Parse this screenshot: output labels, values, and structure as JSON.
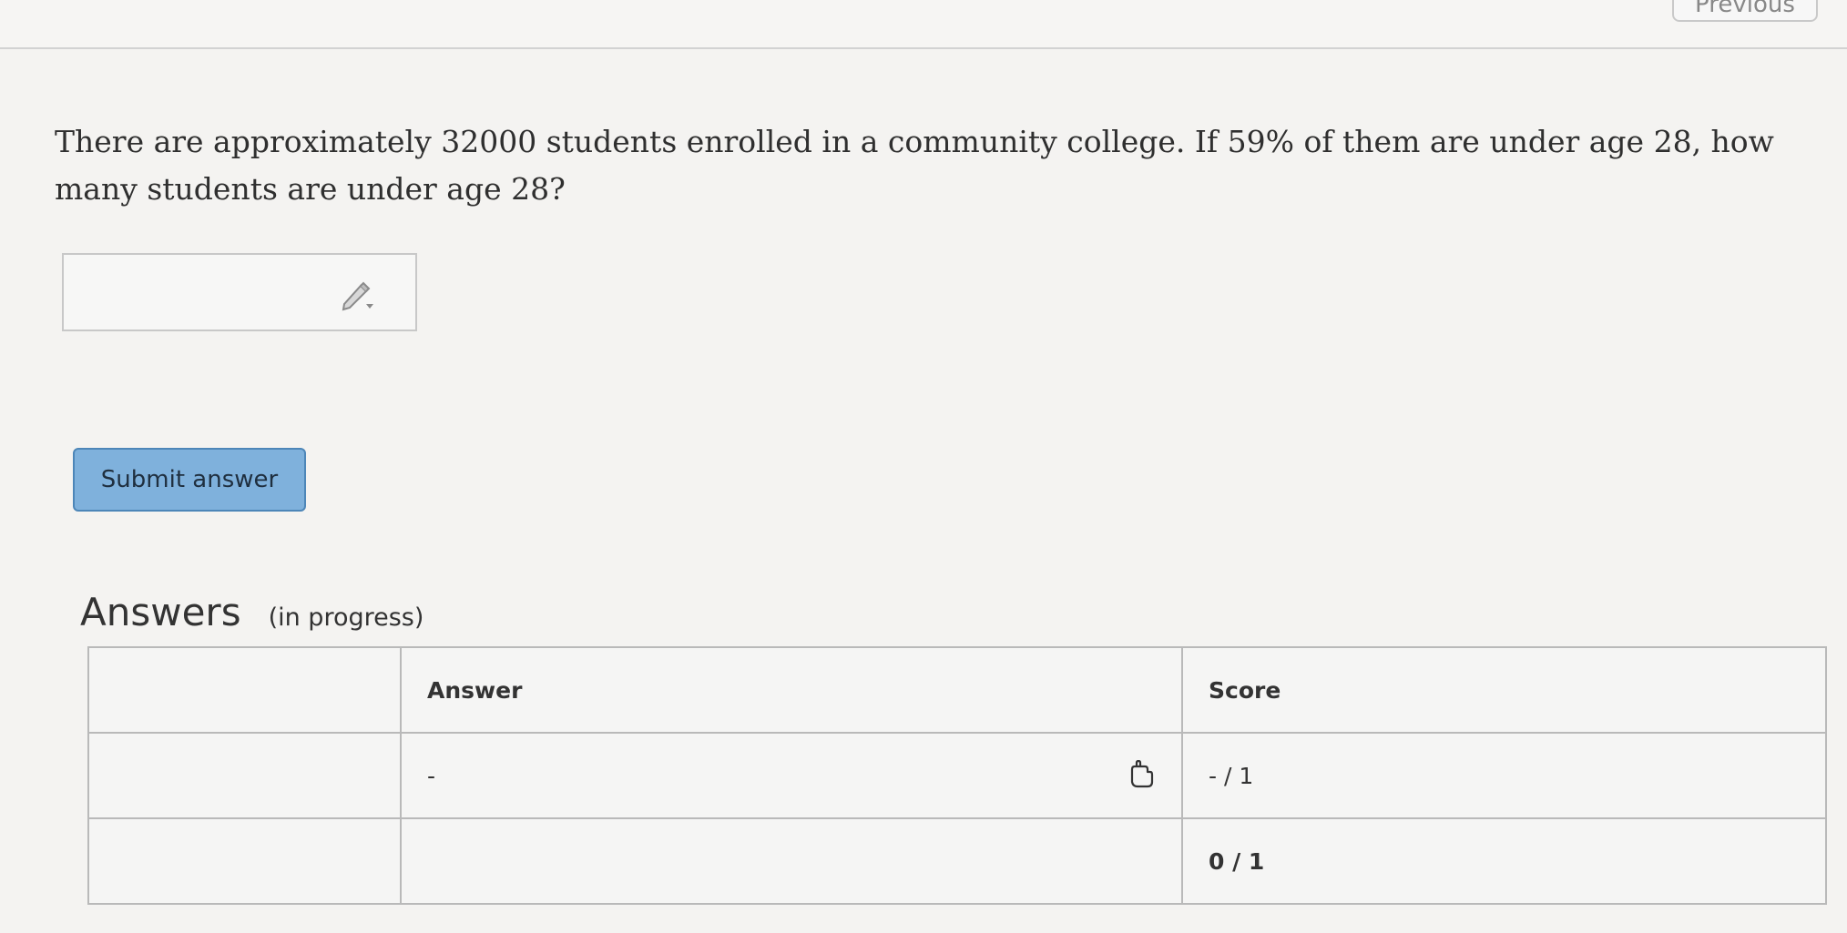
{
  "header": {
    "previous_label": "Previous"
  },
  "question": {
    "text": "There are approximately 32000 students enrolled in a community college. If 59% of them are under age 28, how many students are under age 28?"
  },
  "answer_input": {
    "value": "",
    "icon": "pencil-icon"
  },
  "submit": {
    "label": "Submit answer"
  },
  "answers": {
    "title": "Answers",
    "status": "(in progress)",
    "columns": [
      "",
      "Answer",
      "Score"
    ],
    "rows": [
      {
        "index": "",
        "answer": "-",
        "score": "- / 1",
        "icon": "hand-pointer-icon"
      },
      {
        "index": "",
        "answer": "",
        "score": "0 / 1"
      }
    ]
  },
  "colors": {
    "submit_bg": "#7fb1dc",
    "submit_border": "#4d86b8",
    "background": "#f4f3f1"
  }
}
